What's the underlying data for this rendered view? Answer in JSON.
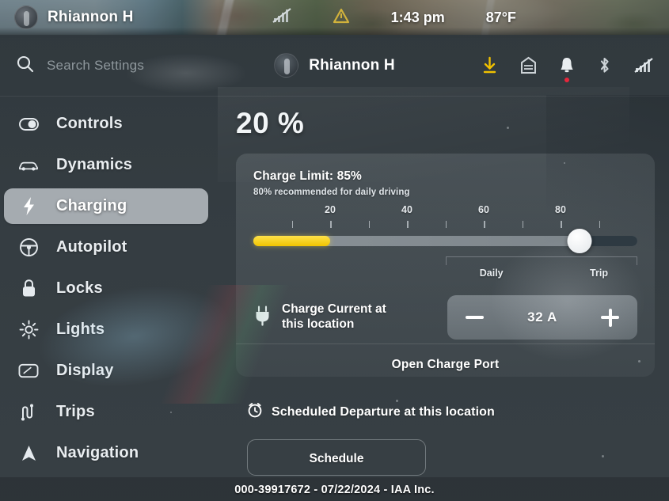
{
  "status_bar": {
    "driver_name": "Rhiannon H",
    "time": "1:43 pm",
    "temperature": "87°F",
    "signal_icon": "signal-off-icon",
    "hazard_icon": "warning-triangle-icon",
    "avatar_icon": "driver-avatar"
  },
  "header": {
    "search_icon": "search-icon",
    "search_placeholder": "Search Settings",
    "profile_name": "Rhiannon H",
    "icons": [
      {
        "name": "software-update-icon",
        "color": "#f0c000"
      },
      {
        "name": "garage-door-icon",
        "color": "#cdd3d7"
      },
      {
        "name": "notification-bell-icon",
        "color": "#e9edf0",
        "badge_color": "#e8263c"
      },
      {
        "name": "bluetooth-icon",
        "color": "#cdd3d7"
      },
      {
        "name": "cellular-signal-off-icon",
        "color": "#cdd3d7"
      }
    ]
  },
  "sidebar": {
    "items": [
      {
        "label": "Controls",
        "icon": "toggle-switch-icon",
        "active": false
      },
      {
        "label": "Dynamics",
        "icon": "car-icon",
        "active": false
      },
      {
        "label": "Charging",
        "icon": "lightning-bolt-icon",
        "active": true
      },
      {
        "label": "Autopilot",
        "icon": "steering-wheel-icon",
        "active": false
      },
      {
        "label": "Locks",
        "icon": "padlock-icon",
        "active": false
      },
      {
        "label": "Lights",
        "icon": "sun-light-icon",
        "active": false
      },
      {
        "label": "Display",
        "icon": "display-screen-icon",
        "active": false
      },
      {
        "label": "Trips",
        "icon": "trips-route-icon",
        "active": false
      },
      {
        "label": "Navigation",
        "icon": "navigation-arrow-icon",
        "active": false
      }
    ]
  },
  "charging": {
    "battery_percent_label": "20 %",
    "charge_limit_title": "Charge Limit: 85%",
    "charge_limit_subtitle": "80% recommended for daily driving",
    "slider": {
      "current_charge_percent": 20,
      "limit_percent": 85,
      "tick_labels": [
        "20",
        "40",
        "60",
        "80"
      ],
      "tick_values": [
        20,
        40,
        60,
        80
      ],
      "minor_tick_values": [
        10,
        20,
        30,
        40,
        50,
        60,
        70,
        80,
        90
      ],
      "range_label_daily": "Daily",
      "range_label_trip": "Trip",
      "daily_label_position": 62,
      "trip_label_position": 90,
      "fill_color": "#f2c400",
      "knob_color": "#ffffff",
      "track_color": "#9aa2a8"
    },
    "charge_current": {
      "icon": "charge-plug-icon",
      "label_line1": "Charge Current at",
      "label_line2": "this location",
      "value": "32 A",
      "decrease_label": "−",
      "increase_label": "+"
    },
    "open_charge_port_label": "Open Charge Port",
    "scheduled_departure": {
      "icon": "alarm-clock-icon",
      "label": "Scheduled Departure at this location",
      "button_label": "Schedule"
    }
  },
  "watermark": {
    "text": "000-39917672 - 07/22/2024 - IAA Inc."
  }
}
